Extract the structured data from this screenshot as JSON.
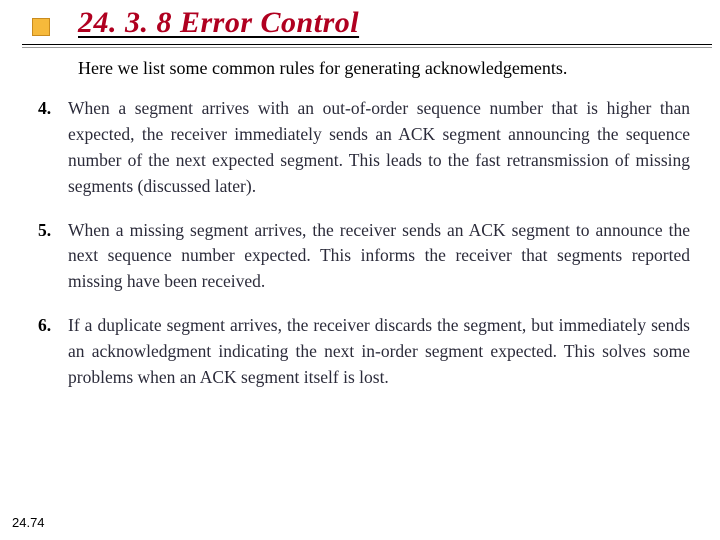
{
  "header": {
    "title": "24. 3. 8  Error Control"
  },
  "intro": "Here we list some common rules for generating acknowledgements.",
  "rules": [
    {
      "num": "4.",
      "text": "When a segment arrives with an out-of-order sequence number that is higher than expected, the receiver immediately sends an ACK segment announcing the sequence number of the next expected segment. This leads to the fast retransmission of missing segments (discussed later)."
    },
    {
      "num": "5.",
      "text": "When a missing segment arrives, the receiver sends an ACK segment to announce the next sequence number expected. This informs the receiver that segments reported missing have been received."
    },
    {
      "num": "6.",
      "text": "If a duplicate segment arrives, the receiver discards the segment, but immediately sends an acknowledgment indicating the next in-order segment expected. This solves some problems when an ACK segment itself is lost."
    }
  ],
  "page_number": "24.74"
}
